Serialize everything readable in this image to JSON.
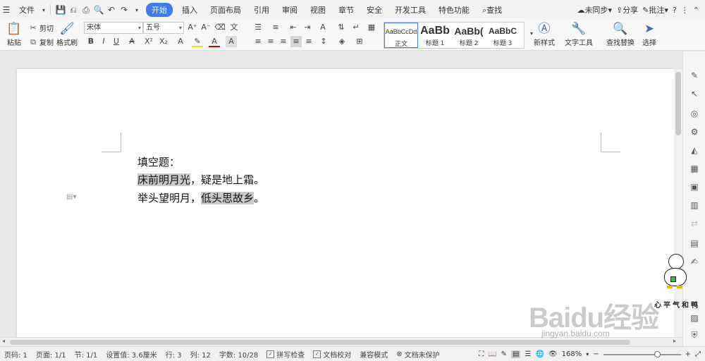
{
  "menubar": {
    "file_label": "文件",
    "tabs": [
      "开始",
      "插入",
      "页面布局",
      "引用",
      "审阅",
      "视图",
      "章节",
      "安全",
      "开发工具",
      "特色功能"
    ],
    "active_tab": "开始",
    "search_label": "查找",
    "sync_label": "未同步",
    "share_label": "分享",
    "comment_label": "批注"
  },
  "ribbon": {
    "paste_label": "粘贴",
    "cut_label": "剪切",
    "copy_label": "复制",
    "format_painter_label": "格式刷",
    "font_name": "宋体",
    "font_size": "五号",
    "styles": [
      {
        "preview": "AaBbCcDd",
        "name": "正文"
      },
      {
        "preview": "AaBb",
        "name": "标题 1"
      },
      {
        "preview": "AaBb(",
        "name": "标题 2"
      },
      {
        "preview": "AaBbC",
        "name": "标题 3"
      }
    ],
    "new_style_label": "新样式",
    "text_tools_label": "文字工具",
    "find_replace_label": "查找替换",
    "select_label": "选择"
  },
  "document": {
    "line1": "填空题：",
    "line2_highlight": "床前明月光",
    "line2_rest": "，疑是地上霜。",
    "line3_start": "举头望明月，",
    "line3_highlight": "低头思故乡",
    "line3_end": "。"
  },
  "status": {
    "page_code": "页码: 1",
    "page": "页面: 1/1",
    "section": "节: 1/1",
    "position": "设置值: 3.6厘米",
    "row": "行: 3",
    "col": "列: 12",
    "word_count": "字数: 10/28",
    "spell_check": "拼写检查",
    "doc_proof": "文档校对",
    "compat_mode": "兼容模式",
    "unprotected": "文档未保护",
    "zoom": "168%"
  },
  "watermark": {
    "brand": "Baidu经验",
    "url": "jingyan.baidu.com",
    "sticker_text": "心平气和鸭"
  }
}
